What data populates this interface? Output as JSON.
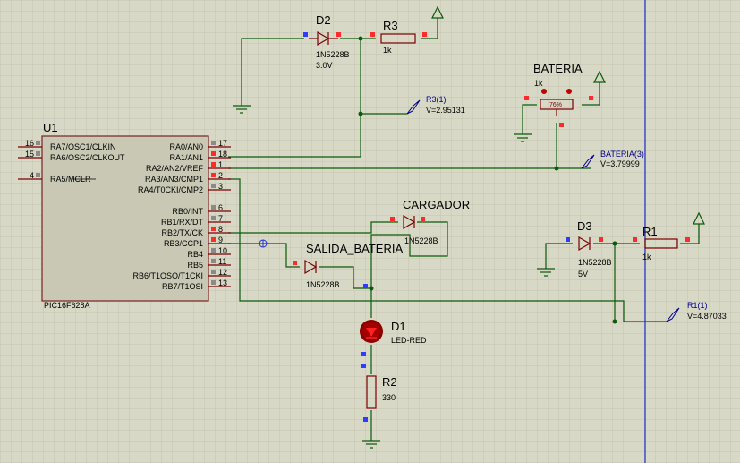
{
  "components": {
    "d2": {
      "ref": "D2",
      "part": "1N5228B",
      "value": "3.0V"
    },
    "r3": {
      "ref": "R3",
      "value": "1k"
    },
    "bateria": {
      "ref": "BATERIA",
      "value": "1k",
      "percent": "76%"
    },
    "u1": {
      "ref": "U1",
      "part": "PIC16F628A"
    },
    "cargador": {
      "ref": "CARGADOR",
      "part": "1N5228B"
    },
    "salida": {
      "ref": "SALIDA_BATERIA",
      "part": "1N5228B"
    },
    "d3": {
      "ref": "D3",
      "part": "1N5228B",
      "value": "5V"
    },
    "r1": {
      "ref": "R1",
      "value": "1k"
    },
    "d1": {
      "ref": "D1",
      "part": "LED-RED"
    },
    "r2": {
      "ref": "R2",
      "value": "330"
    }
  },
  "probes": {
    "r3": {
      "name": "R3(1)",
      "value": "V=2.95131"
    },
    "bateria": {
      "name": "BATERIA(3)",
      "value": "V=3.79999"
    },
    "r1": {
      "name": "R1(1)",
      "value": "V=4.87033"
    }
  },
  "pic_pins_left": [
    {
      "num": "16",
      "name": "RA7/OSC1/CLKIN"
    },
    {
      "num": "15",
      "name": "RA6/OSC2/CLKOUT"
    },
    {
      "num": "4",
      "name": "RA5/MCLR"
    }
  ],
  "pic_pins_right": [
    {
      "num": "17",
      "name": "RA0/AN0"
    },
    {
      "num": "18",
      "name": "RA1/AN1"
    },
    {
      "num": "1",
      "name": "RA2/AN2/VREF"
    },
    {
      "num": "2",
      "name": "RA3/AN3/CMP1"
    },
    {
      "num": "3",
      "name": "RA4/T0CKI/CMP2"
    },
    {
      "num": "6",
      "name": "RB0/INT"
    },
    {
      "num": "7",
      "name": "RB1/RX/DT"
    },
    {
      "num": "8",
      "name": "RB2/TX/CK"
    },
    {
      "num": "9",
      "name": "RB3/CCP1"
    },
    {
      "num": "10",
      "name": "RB4"
    },
    {
      "num": "11",
      "name": "RB5"
    },
    {
      "num": "12",
      "name": "RB6/T1OSO/T1CKI"
    },
    {
      "num": "13",
      "name": "RB7/T1OSI"
    }
  ],
  "colors": {
    "background": "#d8d8c6",
    "grid": "#c4c4b0",
    "wire": "#0b5a0b",
    "ic_fill": "#c8c8b4",
    "probe": "#00008b"
  }
}
